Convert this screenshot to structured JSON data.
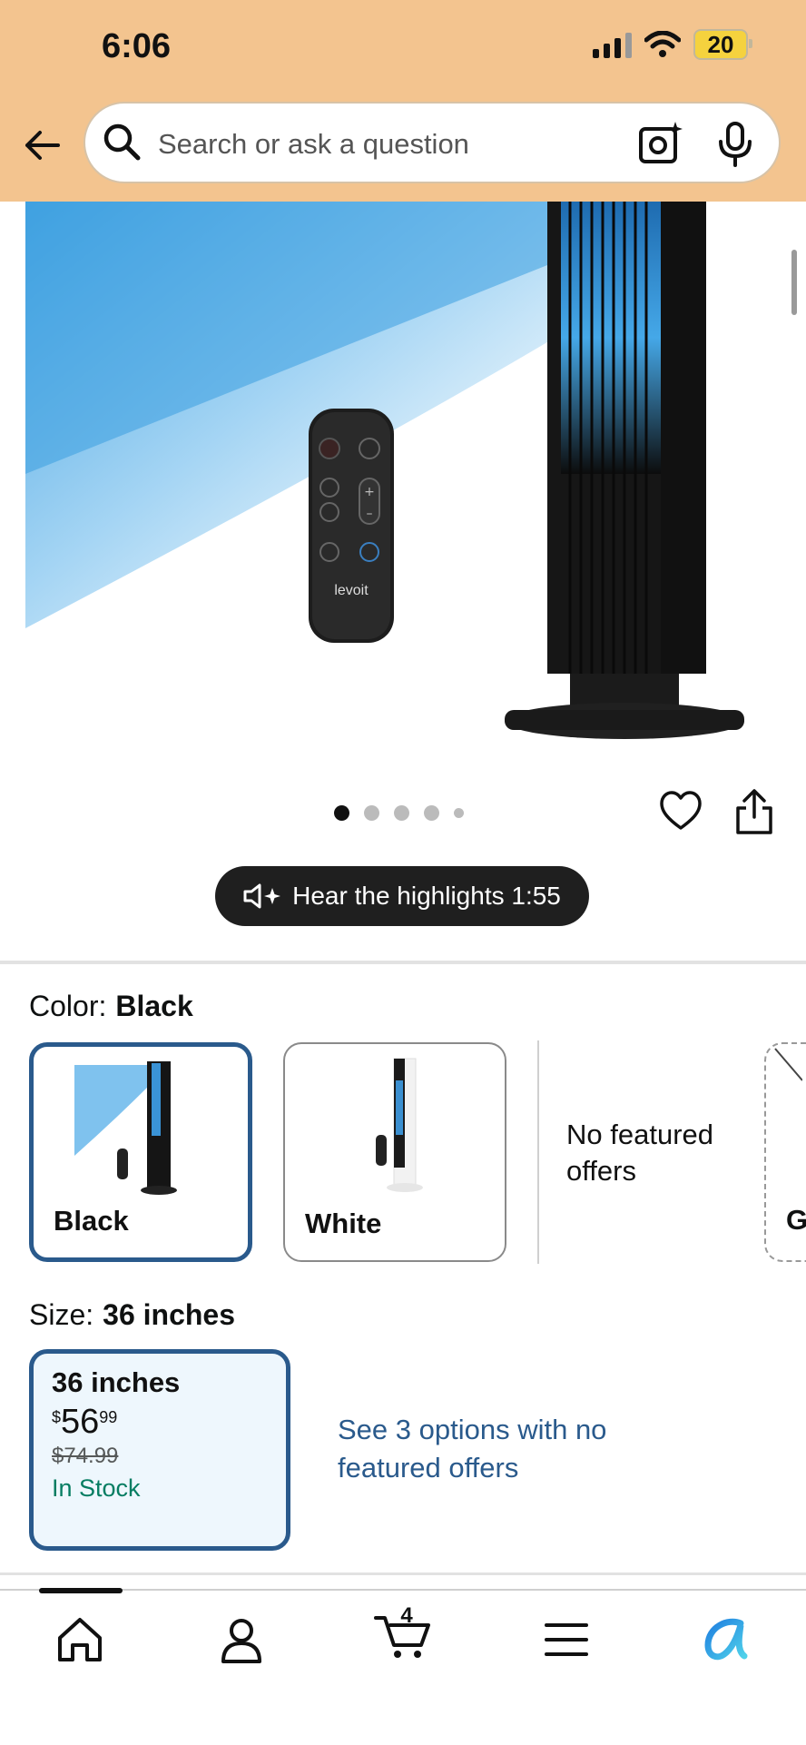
{
  "status": {
    "time": "6:06",
    "battery": "20"
  },
  "search": {
    "placeholder": "Search or ask a question"
  },
  "gallery": {
    "remote_brand": "levoit",
    "dots": 5,
    "active_dot": 1
  },
  "highlights": {
    "label": "Hear the highlights 1:55"
  },
  "color": {
    "label": "Color:",
    "selected": "Black",
    "options": [
      {
        "name": "Black"
      },
      {
        "name": "White"
      }
    ],
    "no_featured": "No featured offers",
    "peek_letter": "G"
  },
  "size": {
    "label": "Size:",
    "selected": "36 inches",
    "card": {
      "title": "36 inches",
      "currency": "$",
      "price_whole": "56",
      "price_fraction": "99",
      "list_price": "$74.99",
      "stock": "In Stock"
    },
    "see_options": "See 3 options with no featured offers"
  },
  "nav": {
    "cart_count": "4"
  },
  "colors": {
    "header": "#f3c48f",
    "selected_border": "#2a5a8c",
    "stock_green": "#067d62",
    "link_blue": "#2a5a8c"
  }
}
